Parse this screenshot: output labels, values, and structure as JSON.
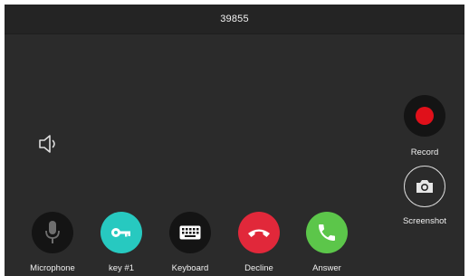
{
  "header": {
    "title": "39855"
  },
  "side_controls": {
    "record_label": "Record",
    "screenshot_label": "Screenshot"
  },
  "bottom_controls": {
    "microphone_label": "Microphone",
    "key_label": "key #1",
    "keyboard_label": "Keyboard",
    "decline_label": "Decline",
    "answer_label": "Answer"
  },
  "icons": {
    "volume": "speaker-icon",
    "record": "record-dot-icon",
    "screenshot": "camera-icon",
    "microphone": "microphone-icon",
    "key": "key-icon",
    "keyboard": "keyboard-icon",
    "decline": "phone-hangup-icon",
    "answer": "phone-answer-icon"
  },
  "colors": {
    "background": "#2b2b2b",
    "titlebar": "#242424",
    "record_dot": "#e0101a",
    "key_button": "#27c9c0",
    "decline_button": "#e1283a",
    "answer_button": "#5cc64a",
    "dark_button": "#141414"
  }
}
